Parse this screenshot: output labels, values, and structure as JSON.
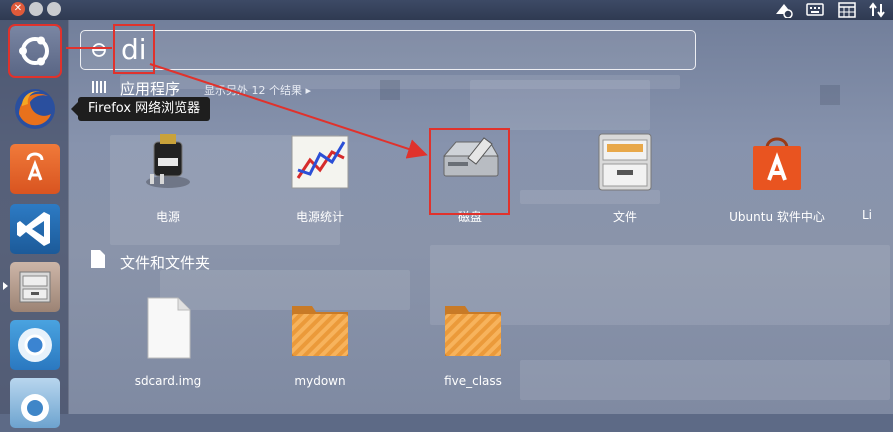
{
  "top_panel": {
    "close_glyph": "✕"
  },
  "tooltip": {
    "text": "Firefox 网络浏览器"
  },
  "search": {
    "query": "di"
  },
  "applications": {
    "header": "应用程序",
    "filter": "显示另外 12 个结果 ▸",
    "items": [
      {
        "label": "电源",
        "icon": "power-plug-icon"
      },
      {
        "label": "电源统计",
        "icon": "power-statistics-icon"
      },
      {
        "label": "磁盘",
        "icon": "disks-icon"
      },
      {
        "label": "文件",
        "icon": "files-icon"
      },
      {
        "label": "Ubuntu 软件中心",
        "icon": "software-center-icon"
      },
      {
        "label": "Li",
        "icon": "partial-app-icon"
      }
    ]
  },
  "files": {
    "header": "文件和文件夹",
    "items": [
      {
        "label": "sdcard.img",
        "icon": "document-icon"
      },
      {
        "label": "mydown",
        "icon": "folder-icon"
      },
      {
        "label": "five_class",
        "icon": "folder-icon"
      }
    ]
  },
  "colors": {
    "highlight": "#e0322c",
    "ubuntu_orange": "#e95420",
    "folder_orange": "#f39a3c"
  }
}
